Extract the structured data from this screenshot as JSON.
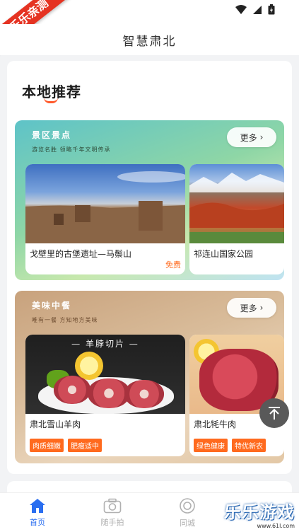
{
  "watermark": "乐乐亲测",
  "app": {
    "title": "智慧肃北"
  },
  "section": {
    "title": "本地推荐"
  },
  "scenic": {
    "name": "景区景点",
    "subtitle": "游览名胜 领略千年文明传承",
    "more": "更多",
    "items": [
      {
        "name": "戈壁里的古堡遗址—马鬃山",
        "price": "免费"
      },
      {
        "name": "祁连山国家公园"
      }
    ]
  },
  "food": {
    "name": "美味中餐",
    "subtitle": "唯有一餐 方知地方美味",
    "more": "更多",
    "banner": "— 羊脖切片 —",
    "items": [
      {
        "name": "肃北雪山羊肉",
        "tags": [
          "肉质细嫩",
          "肥瘦适中"
        ]
      },
      {
        "name": "肃北牦牛肉",
        "tags": [
          "绿色健康",
          "特优新农"
        ]
      }
    ]
  },
  "tabs": [
    {
      "label": "首页",
      "icon": "home-icon",
      "active": true
    },
    {
      "label": "随手拍",
      "icon": "camera-icon",
      "active": false
    },
    {
      "label": "同城",
      "icon": "location-circle-icon",
      "active": false
    }
  ],
  "corner_logo": {
    "text": "乐乐游戏",
    "url": "www.61l.com"
  },
  "colors": {
    "accent": "#2a6ef0",
    "tag": "#ff6a1e",
    "ribbon": "#e53322"
  }
}
